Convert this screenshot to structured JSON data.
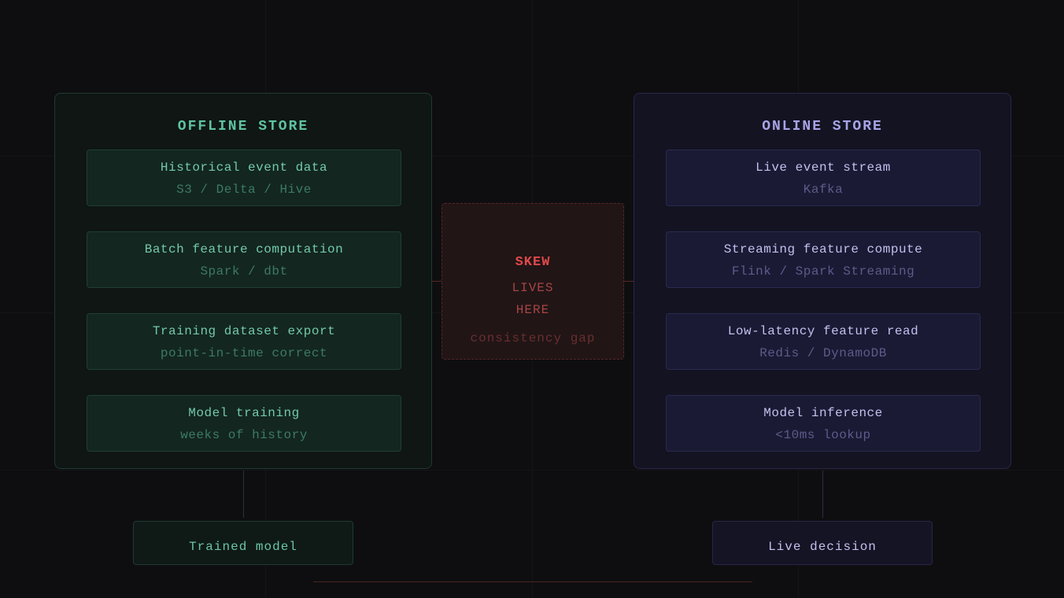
{
  "offline": {
    "title": "OFFLINE STORE",
    "color": "#5fc2a0",
    "steps": [
      {
        "name": "Historical event data",
        "detail": "S3 / Delta / Hive"
      },
      {
        "name": "Batch feature computation",
        "detail": "Spark / dbt"
      },
      {
        "name": "Training dataset export",
        "detail": "point-in-time correct"
      },
      {
        "name": "Model training",
        "detail": "weeks of history"
      }
    ],
    "output": "Trained model"
  },
  "online": {
    "title": "ONLINE STORE",
    "color": "#a9a4e6",
    "steps": [
      {
        "name": "Live event stream",
        "detail": "Kafka"
      },
      {
        "name": "Streaming feature compute",
        "detail": "Flink / Spark Streaming"
      },
      {
        "name": "Low-latency feature read",
        "detail": "Redis / DynamoDB"
      },
      {
        "name": "Model inference",
        "detail": "<10ms lookup"
      }
    ],
    "output": "Live decision"
  },
  "skew": {
    "title": "SKEW",
    "line1": "LIVES",
    "line2": "HERE",
    "note": "consistency gap",
    "color": "#e0494a"
  }
}
